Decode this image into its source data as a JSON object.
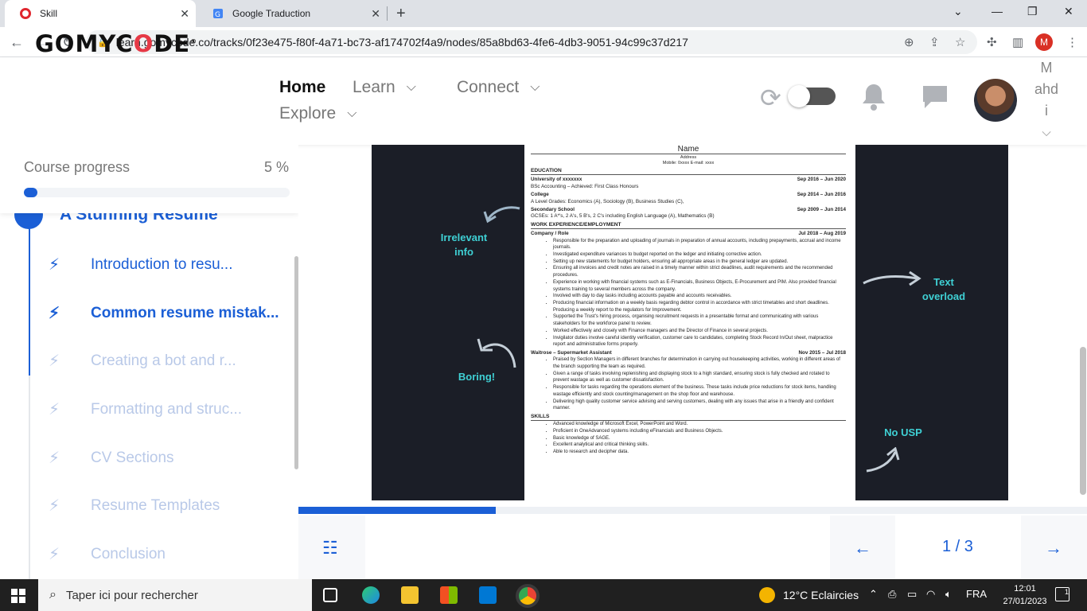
{
  "browser": {
    "tabs": [
      {
        "title": "Skill",
        "active": true
      },
      {
        "title": "Google Traduction",
        "active": false
      }
    ],
    "url": "learn.gomycode.co/tracks/0f23e475-f80f-4a71-bc73-af174702f4a9/nodes/85a8bd63-4fe6-4db3-9051-94c99c37d217",
    "profile_initial": "M"
  },
  "header": {
    "logo": {
      "pre": "GOMYC",
      "o": "O",
      "post": "DE"
    },
    "menu": [
      {
        "label": "Home",
        "active": true
      },
      {
        "label": "Learn"
      },
      {
        "label": "Connect"
      },
      {
        "label": "Explore"
      }
    ],
    "username_lines": [
      "M",
      "ahd",
      "i"
    ]
  },
  "sidebar": {
    "progress_label": "Course progress",
    "progress_value": "5 %",
    "progress_fraction": 0.05,
    "section_title": "A Stunning Resume",
    "lessons": [
      {
        "label": "Introduction to resu...",
        "state": "done"
      },
      {
        "label": "Common resume mistak...",
        "state": "current"
      },
      {
        "label": "Creating a bot and r...",
        "state": "locked"
      },
      {
        "label": "Formatting and struc...",
        "state": "locked"
      },
      {
        "label": "CV Sections",
        "state": "locked"
      },
      {
        "label": "Resume Templates",
        "state": "locked"
      },
      {
        "label": "Conclusion",
        "state": "locked"
      }
    ]
  },
  "slide": {
    "annotations": {
      "irrelevant": "Irrelevant info",
      "text_overload": "Text overload",
      "boring": "Boring!",
      "no_usp": "No USP"
    },
    "resume": {
      "name": "Name",
      "address": "Address",
      "contact": "Mobile: 0xxxx    E-mail: xxxx",
      "education_heading": "EDUCATION",
      "edu": [
        {
          "school": "University of xxxxxxx",
          "dates": "Sep 2016 – Jun 2020",
          "detail": "BSc Accounting – Achieved: First Class Honours"
        },
        {
          "school": "College",
          "dates": "Sep 2014 – Jun 2016",
          "detail": "A Level Grades: Economics (A), Sociology (B), Business Studies (C),"
        },
        {
          "school": "Secondary School",
          "dates": "Sep 2009 – Jun 2014",
          "detail": "GCSEs: 1 A*'s, 2 A's, 5 B's, 2 C's including English Language (A), Mathematics (B)"
        }
      ],
      "work_heading": "WORK EXPERIENCE/EMPLOYMENT",
      "job1": {
        "title": "Company / Role",
        "dates": "Jul 2018 – Aug 2019"
      },
      "job1_bullets": [
        "Responsible for the preparation and uploading of journals in preparation of annual accounts, including prepayments, accrual and income journals.",
        "Investigated expenditure variances to budget reported on the ledger and initiating corrective action.",
        "Setting up new statements for budget holders, ensuring all appropriate areas in the general ledger are updated.",
        "Ensuring all invoices and credit notes are raised in a timely manner within strict deadlines, audit requirements and the recommended procedures.",
        "Experience in working with financial systems such as E-Financials, Business Objects, E-Procurement and PIM. Also provided financial systems training to several members across the company.",
        "Involved with day to day tasks including accounts payable and accounts receivables.",
        "Producing financial information on a weekly basis regarding debtor control in accordance with strict timetables and short deadlines. Producing a weekly report to the regulators for Improvement.",
        "Supported the Trust's hiring process, organising recruitment requests in a presentable format and communicating with various stakeholders for the workforce panel to review.",
        "Worked effectively and closely with Finance managers and the Director of Finance in several projects.",
        "Invigilator duties involve careful identity verification, customer care to candidates, completing Stock Record In/Out sheet, malpractice report and administrative forms properly."
      ],
      "job2": {
        "title": "Waitrose – Supermarket Assistant",
        "dates": "Nov 2015 – Jul 2018"
      },
      "job2_bullets": [
        "Praised by Section Managers in different branches for determination in carrying out housekeeping activities, working in different areas of the branch supporting the team as required.",
        "Given a range of tasks involving replenishing and displaying stock to a high standard, ensuring stock is fully checked and rotated to prevent wastage as well as customer dissatisfaction.",
        "Responsible for tasks regarding the operations element of the business. These tasks include price reductions for stock items, handling wastage efficiently and stock counting/management on the shop floor and warehouse.",
        "Delivering high quality customer service advising and serving customers, dealing with any issues that arise in a friendly and confident manner."
      ],
      "skills_heading": "SKILLS",
      "skills": [
        "Advanced knowledge of Microsoft Excel, PowerPoint and Word.",
        "Proficient in OneAdvanced systems including eFinancials and Business Objects.",
        "Basic knowledge of SAGE.",
        "Excellent analytical and critical thinking skills.",
        "Able to research and decipher data."
      ]
    },
    "progress_fraction": 0.25
  },
  "pager": {
    "text": "1 / 3"
  },
  "taskbar": {
    "search_placeholder": "Taper ici pour rechercher",
    "weather": "12°C  Eclaircies",
    "lang": "FRA",
    "time": "12:01",
    "date": "27/01/2023",
    "notif_count": "1"
  },
  "colors": {
    "accent": "#1b5fd6",
    "annotation": "#3fd0d4",
    "slide_bg": "#1b1e27",
    "logo_o": "#e63946"
  }
}
